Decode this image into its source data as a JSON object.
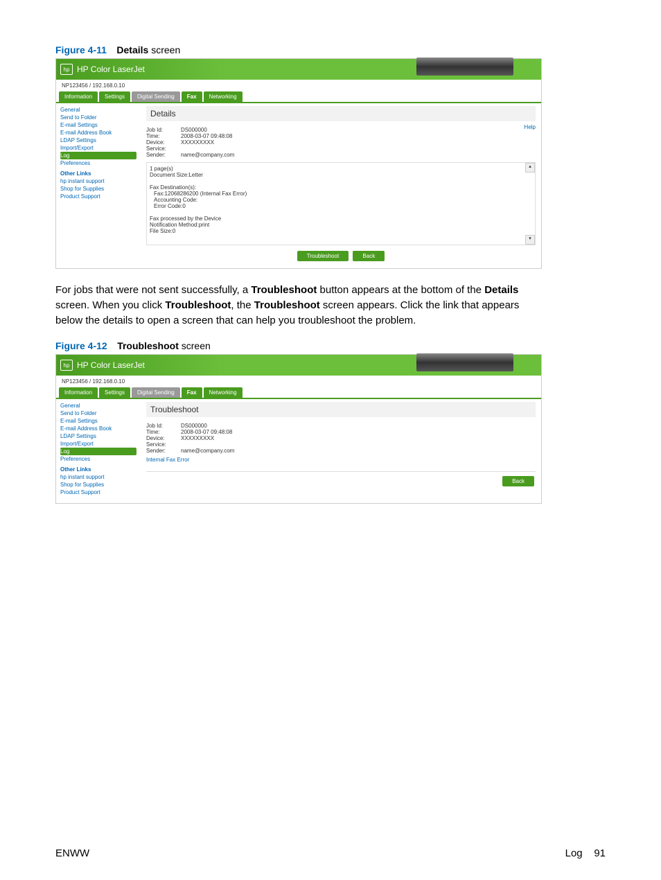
{
  "fig1": {
    "name": "Figure 4-11",
    "boldword": "Details",
    "rest": " screen",
    "product": "HP Color LaserJet",
    "host": "NP123456 / 192.168.0.10",
    "tabs": {
      "t1": "Information",
      "t2": "Settings",
      "t3": "Digital Sending",
      "t4": "Fax",
      "t5": "Networking"
    },
    "sidebar": {
      "s1": "General",
      "s2": "Send to Folder",
      "s3": "E-mail Settings",
      "s4": "E-mail Address Book",
      "s5": "LDAP Settings",
      "s6": "Import/Export",
      "s7": "Log",
      "s8": "Preferences",
      "hdr": "Other Links",
      "o1": "hp instant support",
      "o2": "Shop for Supplies",
      "o3": "Product Support"
    },
    "content": {
      "title": "Details",
      "help": "Help",
      "k1": "Job Id:",
      "v1": "DS000000",
      "k2": "Time:",
      "v2": "2008-03-07 09:48:08",
      "k3": "Device:",
      "v3": "XXXXXXXXX",
      "k4": "Service:",
      "v4": "",
      "k5": "Sender:",
      "v5": "name@company.com",
      "pages": "1 page(s)",
      "docsize": "Document Size:Letter",
      "dest_hdr": "Fax Destination(s):",
      "dest_line": "Fax:12068286200 (Internal Fax Error)",
      "acct": "Accounting Code:",
      "err": "Error Code:0",
      "proc": "Fax processed by the Device",
      "notif": "Notification Method:print",
      "fsize": "File Size:0",
      "btn_ts": "Troubleshoot",
      "btn_back": "Back"
    }
  },
  "para1": {
    "p1a": "For jobs that were not sent successfully, a ",
    "b1": "Troubleshoot",
    "p1b": " button appears at the bottom of the ",
    "b2": "Details",
    "p1c": " screen. When you click ",
    "b3": "Troubleshoot",
    "p1d": ", the ",
    "b4": "Troubleshoot",
    "p1e": " screen appears. Click the link that appears below the details to open a screen that can help you troubleshoot the problem."
  },
  "fig2": {
    "name": "Figure 4-12",
    "boldword": "Troubleshoot",
    "rest": " screen",
    "content": {
      "title": "Troubleshoot",
      "k1": "Job Id:",
      "v1": "DS000000",
      "k2": "Time:",
      "v2": "2008-03-07 09:48:08",
      "k3": "Device:",
      "v3": "XXXXXXXXX",
      "k4": "Service:",
      "v4": "",
      "k5": "Sender:",
      "v5": "name@company.com",
      "errlink": "Internal Fax Error",
      "btn_back": "Back"
    }
  },
  "footer": {
    "left": "ENWW",
    "right_label": "Log",
    "right_page": "91"
  }
}
